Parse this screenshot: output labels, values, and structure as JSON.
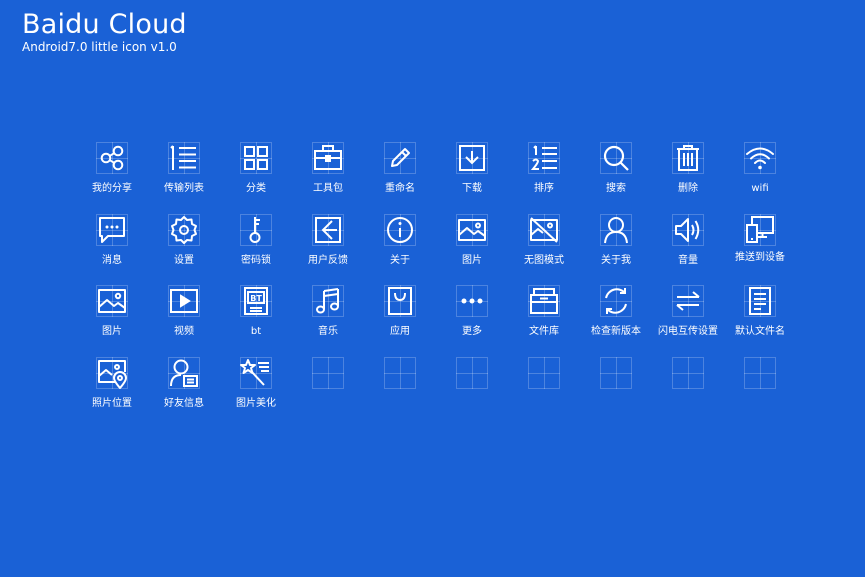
{
  "header": {
    "title": "Baidu Cloud",
    "subtitle": "Android7.0 little icon v1.0"
  },
  "icons": [
    {
      "label": "我的分享",
      "icon": "share-icon"
    },
    {
      "label": "传输列表",
      "icon": "transfer-list-icon"
    },
    {
      "label": "分类",
      "icon": "category-icon"
    },
    {
      "label": "工具包",
      "icon": "toolbox-icon"
    },
    {
      "label": "重命名",
      "icon": "rename-pencil-icon"
    },
    {
      "label": "下载",
      "icon": "download-icon"
    },
    {
      "label": "排序",
      "icon": "sort-icon"
    },
    {
      "label": "搜索",
      "icon": "search-icon"
    },
    {
      "label": "删除",
      "icon": "trash-icon"
    },
    {
      "label": "wifi",
      "icon": "wifi-icon"
    },
    {
      "label": "消息",
      "icon": "message-icon"
    },
    {
      "label": "设置",
      "icon": "gear-icon"
    },
    {
      "label": "密码锁",
      "icon": "key-icon"
    },
    {
      "label": "用户反馈",
      "icon": "feedback-icon"
    },
    {
      "label": "关于",
      "icon": "info-icon"
    },
    {
      "label": "图片",
      "icon": "image-icon"
    },
    {
      "label": "无图模式",
      "icon": "no-image-icon"
    },
    {
      "label": "关于我",
      "icon": "user-icon"
    },
    {
      "label": "音量",
      "icon": "volume-icon"
    },
    {
      "label": "推送到设备",
      "icon": "push-device-icon"
    },
    {
      "label": "图片",
      "icon": "picture-icon"
    },
    {
      "label": "视频",
      "icon": "video-icon"
    },
    {
      "label": "bt",
      "icon": "bt-file-icon"
    },
    {
      "label": "音乐",
      "icon": "music-icon"
    },
    {
      "label": "应用",
      "icon": "app-bag-icon"
    },
    {
      "label": "更多",
      "icon": "more-icon"
    },
    {
      "label": "文件库",
      "icon": "file-library-icon"
    },
    {
      "label": "检查新版本",
      "icon": "refresh-icon"
    },
    {
      "label": "闪电互传设置",
      "icon": "swap-arrows-icon"
    },
    {
      "label": "默认文件名",
      "icon": "document-icon"
    },
    {
      "label": "照片位置",
      "icon": "photo-location-icon"
    },
    {
      "label": "好友信息",
      "icon": "friend-info-icon"
    },
    {
      "label": "图片美化",
      "icon": "magic-wand-icon"
    }
  ]
}
